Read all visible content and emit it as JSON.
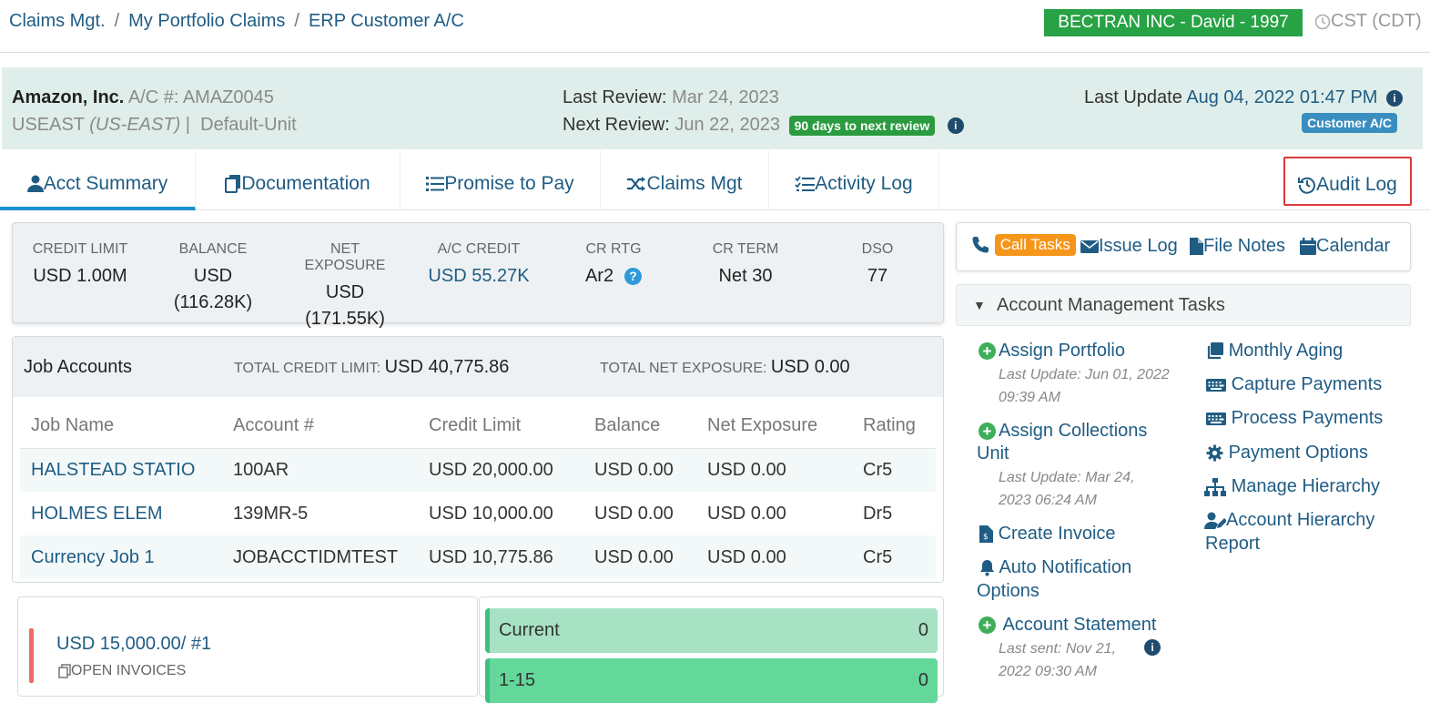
{
  "breadcrumb": {
    "items": [
      "Claims Mgt.",
      "My Portfolio Claims",
      "ERP Customer A/C"
    ],
    "separator": "/"
  },
  "tenant": {
    "label": "BECTRAN INC - David - 1997"
  },
  "timezone": {
    "label": "CST (CDT)"
  },
  "account": {
    "name": "Amazon, Inc.",
    "ac_label": "A/C #:",
    "ac_number": "AMAZ0045",
    "region": "USEAST",
    "region_code": "(US-EAST)",
    "divider": "|",
    "unit": "Default-Unit",
    "last_review_label": "Last Review:",
    "last_review": "Mar 24, 2023",
    "next_review_label": "Next Review:",
    "next_review": "Jun 22, 2023",
    "review_badge": "90 days to next review",
    "last_update_label": "Last Update",
    "last_update": "Aug 04, 2022 01:47 PM",
    "type_badge": "Customer A/C"
  },
  "tabs": [
    {
      "label": "Acct Summary",
      "icon": "user-icon",
      "active": true
    },
    {
      "label": "Documentation",
      "icon": "documents-icon"
    },
    {
      "label": "Promise to Pay",
      "icon": "list-icon"
    },
    {
      "label": "Claims Mgt",
      "icon": "shuffle-icon"
    },
    {
      "label": "Activity Log",
      "icon": "checklist-icon"
    },
    {
      "label": "Audit Log",
      "icon": "history-icon"
    }
  ],
  "summary": {
    "credit_limit": {
      "label": "CREDIT LIMIT",
      "value": "USD 1.00M"
    },
    "balance": {
      "label": "BALANCE",
      "value1": "USD",
      "value2": "(116.28K)"
    },
    "net_exposure": {
      "label": "NET EXPOSURE",
      "value1": "USD",
      "value2": "(171.55K)"
    },
    "ac_credit": {
      "label": "A/C CREDIT",
      "value": "USD 55.27K"
    },
    "cr_rtg": {
      "label": "CR RTG",
      "value": "Ar2"
    },
    "cr_term": {
      "label": "CR TERM",
      "value": "Net 30"
    },
    "dso": {
      "label": "DSO",
      "value": "77"
    }
  },
  "jobs": {
    "title": "Job Accounts",
    "total_credit_label": "TOTAL CREDIT LIMIT:",
    "total_credit": "USD 40,775.86",
    "total_net_label": "TOTAL NET EXPOSURE:",
    "total_net": "USD 0.00",
    "columns": [
      "Job Name",
      "Account #",
      "Credit Limit",
      "Balance",
      "Net Exposure",
      "Rating"
    ],
    "rows": [
      [
        "HALSTEAD STATIO",
        "100AR",
        "USD 20,000.00",
        "USD 0.00",
        "USD 0.00",
        "Cr5"
      ],
      [
        "HOLMES ELEM",
        "139MR-5",
        "USD 10,000.00",
        "USD 0.00",
        "USD 0.00",
        "Dr5"
      ],
      [
        "Currency Job 1",
        "JOBACCTIDMTEST",
        "USD 10,775.86",
        "USD 0.00",
        "USD 0.00",
        "Cr5"
      ]
    ]
  },
  "invoices": {
    "amount": "USD 15,000.00/ #1",
    "open_label": "OPEN INVOICES"
  },
  "aging": [
    {
      "label": "Current",
      "count": "0"
    },
    {
      "label": "1-15",
      "count": "0"
    }
  ],
  "quick_links": {
    "call_tasks": "Call Tasks",
    "issue_log": "Issue Log",
    "file_notes": "File Notes",
    "calendar": "Calendar"
  },
  "amt": {
    "title": "Account Management Tasks",
    "assign_portfolio": "Assign Portfolio",
    "assign_portfolio_sub1": "Last Update: Jun 01, 2022",
    "assign_portfolio_sub2": "09:39 AM",
    "assign_collections1": "Assign Collections",
    "assign_collections2": "Unit",
    "assign_collections_sub1": "Last Update: Mar 24,",
    "assign_collections_sub2": "2023 06:24 AM",
    "create_invoice": "Create Invoice",
    "auto_notification1": "Auto Notification",
    "auto_notification2": "Options",
    "account_statement": "Account Statement",
    "account_statement_sub1": "Last sent: Nov 21,",
    "account_statement_sub2": "2022 09:30 AM",
    "monthly_aging": "Monthly Aging",
    "capture_payments": "Capture Payments",
    "process_payments": "Process Payments",
    "payment_options": "Payment Options",
    "manage_hierarchy": "Manage Hierarchy",
    "account_hierarchy_report1": "Account Hierarchy",
    "account_hierarchy_report2": "Report"
  },
  "colors": {
    "accent": "#1f5c84",
    "tenant_green": "#27a244",
    "tab_active": "#1b8fd1",
    "highlight_red": "#d93a3a",
    "call_tasks_orange": "#f5961a",
    "header_bg": "#dfeeea"
  }
}
